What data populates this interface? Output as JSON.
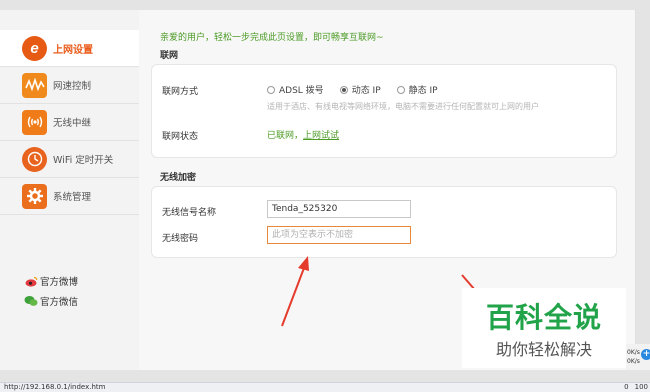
{
  "sidebar": {
    "items": [
      {
        "label": "上网设置",
        "icon": "internet-e-icon",
        "active": true
      },
      {
        "label": "网速控制",
        "icon": "speed-wave-icon"
      },
      {
        "label": "无线中继",
        "icon": "wireless-relay-icon"
      },
      {
        "label": "WiFi 定时开关",
        "icon": "wifi-timer-icon"
      },
      {
        "label": "系统管理",
        "icon": "gear-icon"
      }
    ],
    "social": [
      {
        "label": "官方微博",
        "icon": "weibo-icon"
      },
      {
        "label": "官方微信",
        "icon": "wechat-icon"
      }
    ]
  },
  "main": {
    "welcome": "亲爱的用户，轻松一步完成此页设置，即可畅享互联网~",
    "internet": {
      "title": "联网",
      "mode_label": "联网方式",
      "options": [
        "ADSL 拨号",
        "动态 IP",
        "静态 IP"
      ],
      "selected": "动态 IP",
      "hint": "适用于酒店、有线电视等网络环境，电脑不需要进行任何配置就可上网的用户",
      "status_label": "联网状态",
      "status_text": "已联网，",
      "status_link": "上网试试"
    },
    "wireless": {
      "title": "无线加密",
      "ssid_label": "无线信号名称",
      "ssid_value": "Tenda_525320",
      "password_label": "无线密码",
      "password_placeholder": "此项为空表示不加密"
    }
  },
  "watermark": {
    "title": "百科全说",
    "subtitle": "助你轻松解决"
  },
  "speed": {
    "up": "0K/s",
    "down": "0K/s"
  },
  "statusbar": {
    "url": "http://192.168.0.1/index.htm",
    "zoom": "100",
    "count": "0"
  },
  "colors": {
    "accent": "#e95b1a",
    "green": "#4b9b26",
    "arrow": "#e53b2c"
  }
}
